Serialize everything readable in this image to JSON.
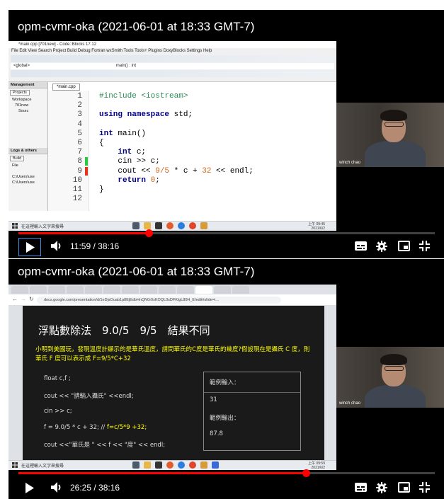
{
  "player1": {
    "title": "opm-cvmr-oka (2021-06-01 at 18:33 GMT-7)",
    "time": "11:59 / 38:16",
    "progress": 0.313,
    "ide": {
      "window_title": "*main.cpp [701new] - Code::Blocks 17.12",
      "menu": "File  Edit  View  Search  Project  Build  Debug  Fortran  wxSmith  Tools  Tools+  Plugins  DoxyBlocks  Settings  Help",
      "combo_global": "<global>",
      "combo_main": "main() : int",
      "combo_debug": "Debug",
      "panel_management": "Management",
      "panel_projects": "Projects",
      "tree_workspace": "Workspace",
      "tree_project": "701new",
      "tree_sources": "Sourc",
      "panel_logs": "Logs & others",
      "panel_build": "Build",
      "log_file": "File",
      "log_line1": "C:\\Users\\use",
      "log_line2": "C:\\Users\\use",
      "editor_tab": "*main.cpp",
      "lines": [
        {
          "n": "1",
          "parts": [
            [
              "pp",
              "#include <iostream>"
            ]
          ]
        },
        {
          "n": "2",
          "parts": []
        },
        {
          "n": "3",
          "parts": [
            [
              "kw",
              "using namespace"
            ],
            [
              "",
              " std;"
            ]
          ]
        },
        {
          "n": "4",
          "parts": []
        },
        {
          "n": "5",
          "parts": [
            [
              "kw",
              "int"
            ],
            [
              "",
              " main()"
            ]
          ]
        },
        {
          "n": "6",
          "parts": [
            [
              "",
              "{"
            ]
          ]
        },
        {
          "n": "7",
          "parts": [
            [
              "",
              "    "
            ],
            [
              "kw",
              "int"
            ],
            [
              "",
              " c;"
            ]
          ]
        },
        {
          "n": "8",
          "parts": [
            [
              "",
              "    cin >> c;"
            ]
          ]
        },
        {
          "n": "9",
          "parts": [
            [
              "",
              "    cout << "
            ],
            [
              "num",
              "9/5"
            ],
            [
              "",
              " * c + "
            ],
            [
              "num",
              "32"
            ],
            [
              "",
              " << endl;"
            ]
          ]
        },
        {
          "n": "10",
          "parts": [
            [
              "",
              "    "
            ],
            [
              "kw",
              "return"
            ],
            [
              "",
              " "
            ],
            [
              "num",
              "0"
            ],
            [
              "",
              ";"
            ]
          ]
        },
        {
          "n": "11",
          "parts": [
            [
              "",
              "}"
            ]
          ]
        },
        {
          "n": "12",
          "parts": []
        }
      ]
    },
    "taskbar": {
      "search": "在這裡輸入文字來搜尋",
      "time": "上午 09:45",
      "date": "2021/6/2"
    },
    "cam_name": "winch chao"
  },
  "player2": {
    "title": "opm-cvmr-oka (2021-06-01 at 18:33 GMT-7)",
    "time": "26:25 / 38:16",
    "progress": 0.69,
    "browser": {
      "url": "docs.google.com/presentation/d/1eDjsOuab1p8EjEdbHnQN0r0xKOQL0sDFKlgL80H_E/edit#slide=i..."
    },
    "slide": {
      "title": "浮點數除法　9.0/5　9/5　結果不同",
      "desc": "小明到美國玩，發現溫度計顯示的是華氏溫度，請問華氏的C度是華氏的幾度?假設現在是攝氏 C 度，則華氏 F 度可以表示成 F=9/5*C+32",
      "code1": "float c,f ;",
      "code2": "cout << \"請輸入攝氏\" <<endl;",
      "code3": "cin >> c;",
      "code4a": "f = 9.0/5 * c + 32;   //",
      "code4b": " f=c/5*9 +32;",
      "code5": "cout <<\"華氏是 \" << f << \"度\" << endl;",
      "io_label_in": "範例輸入：",
      "io_val_in": "31",
      "io_label_out": "範例輸出：",
      "io_val_out": "87.8"
    },
    "taskbar": {
      "search": "在這裡輸入文字來搜尋",
      "time": "上午 09:59",
      "date": "2021/6/2"
    },
    "cam_name": "winch chao"
  },
  "colors": {
    "progress": "#ff0000",
    "focus_ring": "#3a8ee6",
    "slide_highlight": "#ffff00"
  }
}
